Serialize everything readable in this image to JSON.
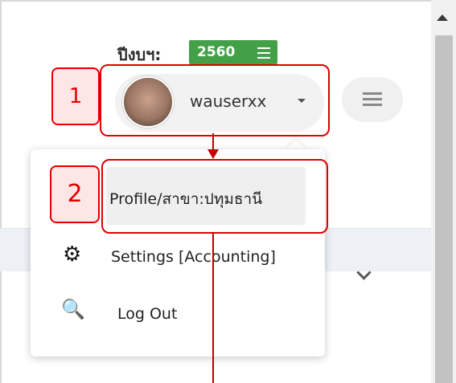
{
  "fiscal_year": {
    "label": "ปีงบฯ:",
    "value": "2560"
  },
  "user": {
    "name": "wauserxx"
  },
  "menu": {
    "items": [
      {
        "label": "Profile/สาขา:ปทุมธานี",
        "icon": "briefcase-icon"
      },
      {
        "label": "Settings [Accounting]",
        "icon": "gear-icon"
      },
      {
        "label": "Log Out",
        "icon": "key-icon"
      }
    ]
  },
  "annotations": {
    "step1": "1",
    "step2": "2"
  },
  "colors": {
    "badge": "#43a047",
    "callout": "#e00000",
    "arrow": "#c00000"
  }
}
